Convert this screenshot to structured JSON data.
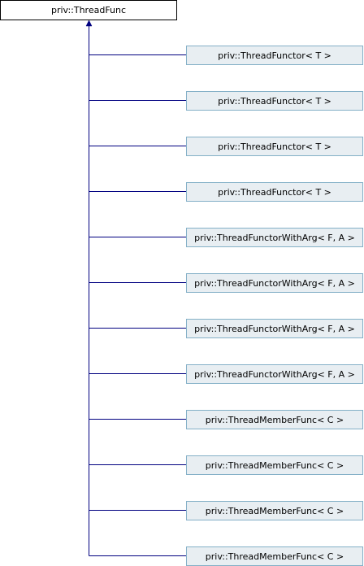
{
  "diagram": {
    "base_class": "priv::ThreadFunc",
    "derived_classes": [
      "priv::ThreadFunctor< T >",
      "priv::ThreadFunctor< T >",
      "priv::ThreadFunctor< T >",
      "priv::ThreadFunctor< T >",
      "priv::ThreadFunctorWithArg< F, A >",
      "priv::ThreadFunctorWithArg< F, A >",
      "priv::ThreadFunctorWithArg< F, A >",
      "priv::ThreadFunctorWithArg< F, A >",
      "priv::ThreadMemberFunc< C >",
      "priv::ThreadMemberFunc< C >",
      "priv::ThreadMemberFunc< C >",
      "priv::ThreadMemberFunc< C >"
    ],
    "colors": {
      "line": "#000080",
      "child_fill": "#e8eef2",
      "child_border": "#84b0c7",
      "base_fill": "#ffffff",
      "base_border": "#000000"
    }
  }
}
